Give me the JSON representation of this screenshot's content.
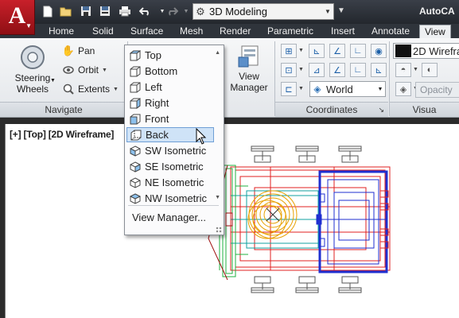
{
  "app": {
    "title": "AutoCA",
    "workspace": "3D Modeling"
  },
  "qat": {
    "icons": [
      "new-icon",
      "open-icon",
      "save-icon",
      "save-as-icon",
      "print-icon",
      "undo-icon",
      "redo-icon"
    ]
  },
  "tabs": [
    "Home",
    "Solid",
    "Surface",
    "Mesh",
    "Render",
    "Parametric",
    "Insert",
    "Annotate",
    "View"
  ],
  "active_tab": "View",
  "navigate": {
    "steering_line1": "Steering",
    "steering_line2": "Wheels",
    "pan": "Pan",
    "orbit": "Orbit",
    "extents": "Extents",
    "panel_label": "Navigate"
  },
  "views": {
    "view_manager_line1": "View",
    "view_manager_line2": "Manager"
  },
  "coordinates": {
    "ucs_name": "World",
    "panel_label": "Coordinates"
  },
  "visual_styles": {
    "current": "2D Wirefra",
    "opacity_label": "Opacity",
    "panel_label": "Visua"
  },
  "viewport": {
    "label": "[+] [Top] [2D Wireframe]"
  },
  "view_menu": {
    "items": [
      "Top",
      "Bottom",
      "Left",
      "Right",
      "Front",
      "Back",
      "SW Isometric",
      "SE Isometric",
      "NE Isometric",
      "NW Isometric"
    ],
    "highlighted": "Back",
    "manager_label": "View Manager..."
  },
  "colors": {
    "app_button": "#c8202a",
    "highlight": "#cfe3f7",
    "drawing_red": "#e02020",
    "drawing_blue": "#1f2fd0",
    "drawing_green": "#20b040",
    "drawing_teal": "#10a0a0",
    "drawing_orange": "#e8a000",
    "drawing_dark_red": "#a01010"
  }
}
